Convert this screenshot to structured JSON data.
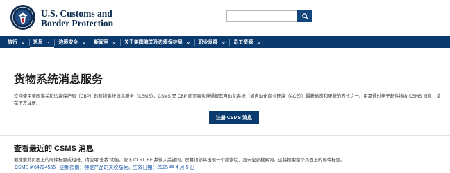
{
  "header": {
    "agency_line1": "U.S. Customs and",
    "agency_line2": "Border Protection",
    "search": {
      "placeholder": "",
      "value": ""
    }
  },
  "nav": {
    "items": [
      {
        "label": "旅行",
        "active": false
      },
      {
        "label": "贸易",
        "active": true
      },
      {
        "label": "边境安全",
        "active": false
      },
      {
        "label": "新闻室",
        "active": false
      },
      {
        "label": "关于美国海关及边境保护局",
        "active": false
      },
      {
        "label": "职业发展",
        "active": false
      },
      {
        "label": "员工资源",
        "active": false
      }
    ]
  },
  "main": {
    "title": "货物系统消息服务",
    "intro": "欢迎使用美国海关和边境保护局（CBP）的货物系统消息服务（CSMS）。CSMS 是 CBP 向贸易伙伴通报其自动化系统（如自动化商业环境（ACE））最新动态和更新的方式之一。用需通过电子邮件接收 CSMS 消息，请在下方注册。",
    "subscribe_label": "注册 CSMS 消息",
    "recent_title": "查看最近的 CSMS 消息",
    "recent_desc": "要搜索此页面上的邮件标题或短语，请使用“查找”功能。按下 CTRL + F 并输入关键词。屏幕顶部将出现一个搜索栏，显示全部搜索词。这将搜索整个页面上的邮件标题。",
    "latest_message": "CSMS # 64724565 - 更新指南：特定产品的关税豁免，生效日期：2025 年 4 月 5 日"
  },
  "colors": {
    "nav_bg": "#0b3b6e",
    "brand_text": "#0d2b4f",
    "button_bg": "#0b3b6e",
    "link": "#1a56a8"
  }
}
